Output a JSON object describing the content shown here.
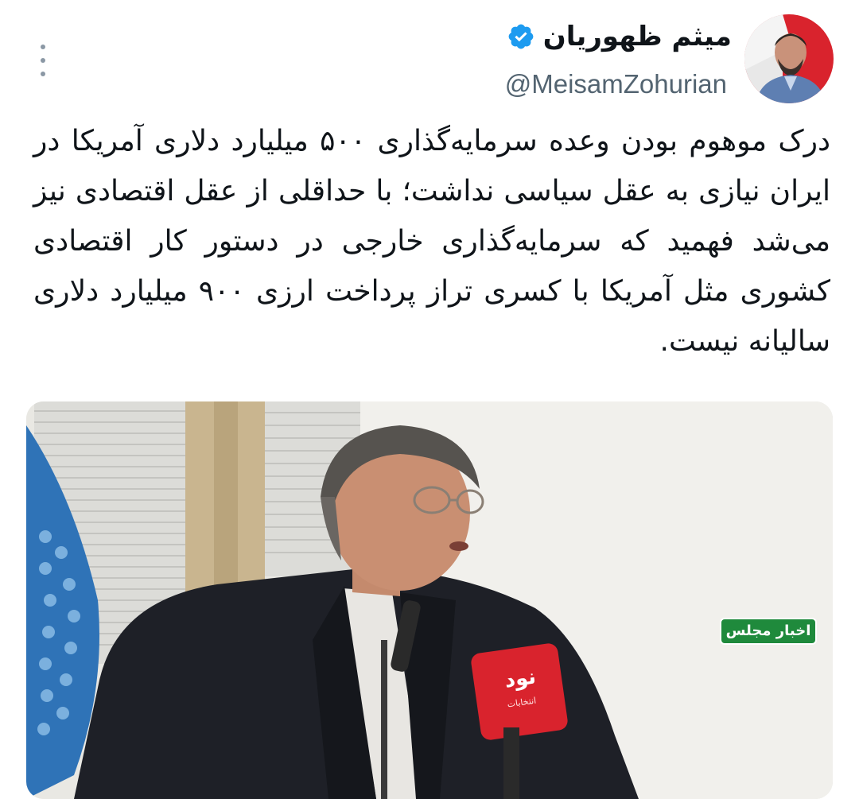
{
  "author": {
    "name": "میثم ظهوریان",
    "handle": "@MeisamZohurian",
    "verified": true,
    "verified_color": "#1d9bf0"
  },
  "tweet": {
    "text": "درک موهوم بودن وعده سرمایه‌گذاری ۵۰۰ میلیارد دلاری آمریکا در ایران نیازی به عقل سیاسی نداشت؛ با حداقلی از عقل اقتصادی نیز می‌شد فهمید که سرمایه‌گذاری خارجی در دستور کار اقتصادی کشوری مثل آمریکا با کسری تراز پرداخت ارزی ۹۰۰ میلیارد دلاری سالیانه نیست."
  },
  "media": {
    "channel_badge": "اخبار مجلس",
    "mic_brand": "نود",
    "mic_sub": "انتخابات"
  },
  "icons": {
    "more": "more-vertical-icon",
    "verified": "verified-badge-icon"
  },
  "colors": {
    "text_primary": "#0f1419",
    "text_secondary": "#536471",
    "accent": "#1d9bf0",
    "badge_green": "#1f8a3c",
    "mic_red": "#d9232d"
  }
}
